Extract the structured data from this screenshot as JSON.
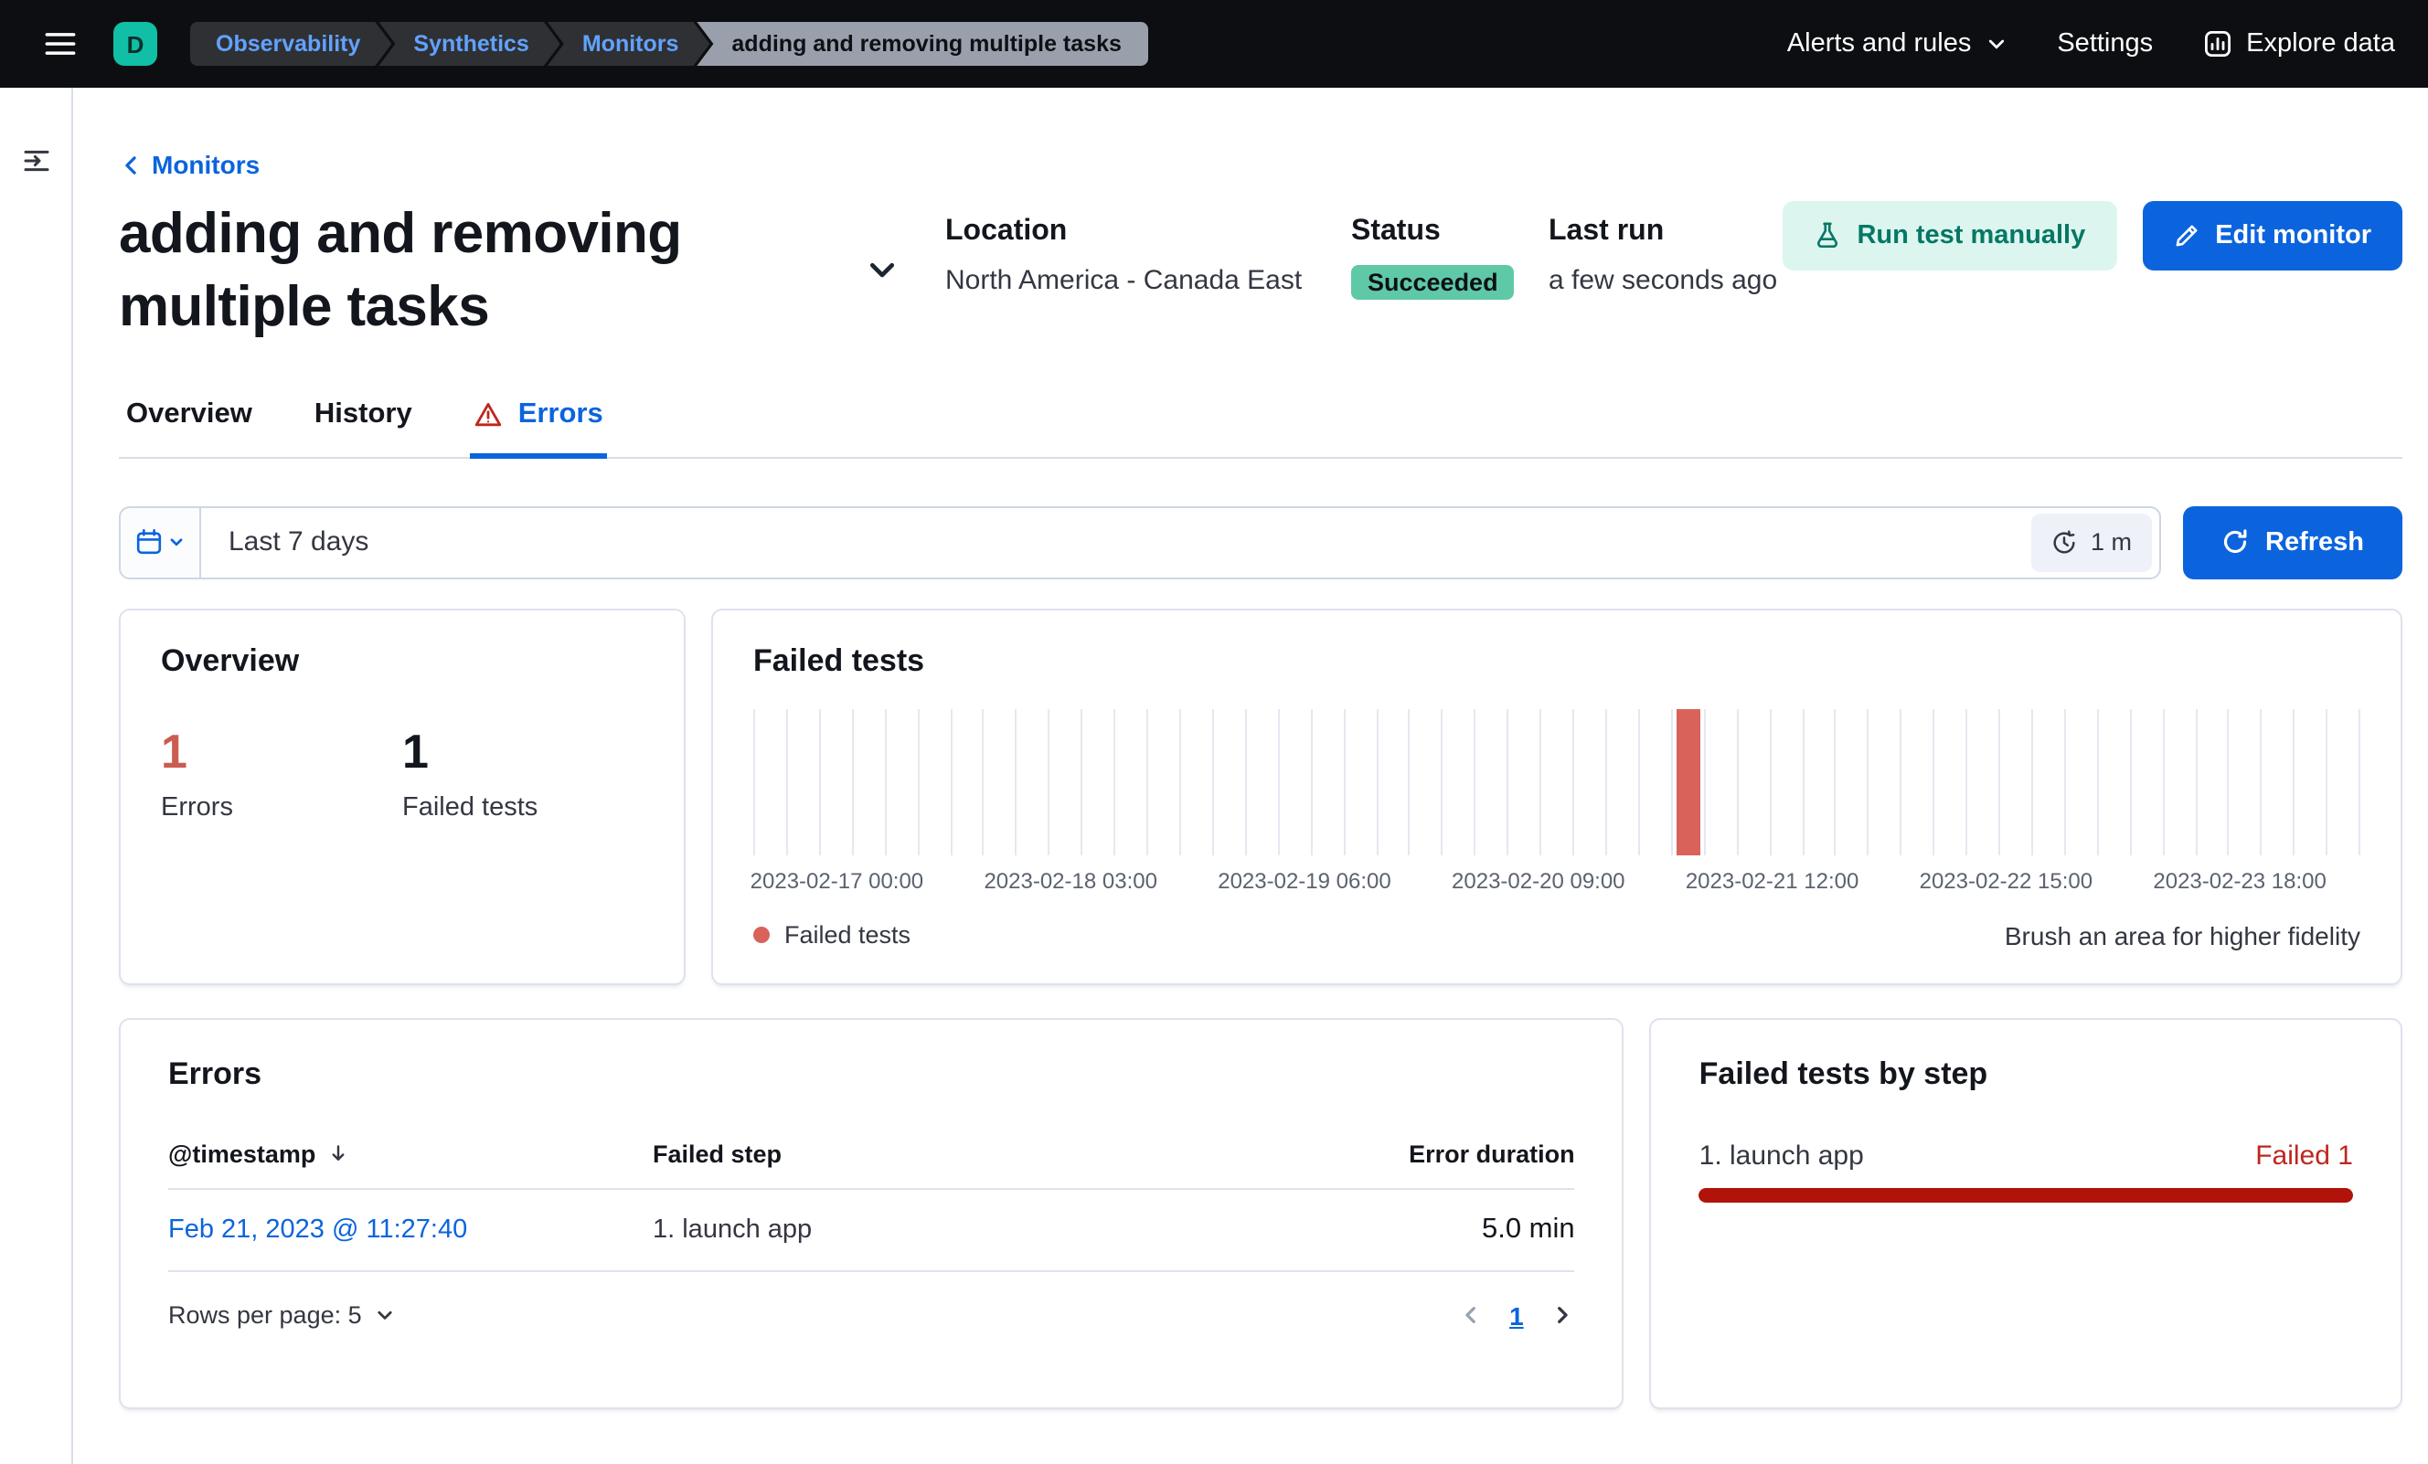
{
  "colors": {
    "header_bg": "#0d0e12",
    "logo_teal": "#10bfa5",
    "breadcrumb_link": "#61a2ff",
    "breadcrumb_current_bg": "#9aa0ab",
    "primary": "#0b64dd",
    "danger": "#bd271e",
    "bar_red": "#d9635a",
    "count_red": "#ca5c51",
    "progress_red": "#b1130a",
    "badge_success_bg": "#5fc9a7",
    "run_button_bg": "#dcf6ef",
    "run_button_text": "#077765"
  },
  "topbar": {
    "logo_letter": "D",
    "breadcrumbs": [
      "Observability",
      "Synthetics",
      "Monitors",
      "adding and removing multiple tasks"
    ],
    "alerts_menu": "Alerts and rules",
    "settings": "Settings",
    "explore_data": "Explore data"
  },
  "page": {
    "back_link": "Monitors",
    "title": "adding and removing multiple tasks",
    "location_label": "Location",
    "location_value": "North America - Canada East",
    "status_label": "Status",
    "status_value": "Succeeded",
    "last_run_label": "Last run",
    "last_run_value": "a few seconds ago",
    "run_test_button": "Run test manually",
    "edit_button": "Edit monitor"
  },
  "tabs": [
    {
      "label": "Overview",
      "active": false
    },
    {
      "label": "History",
      "active": false
    },
    {
      "label": "Errors",
      "active": true
    }
  ],
  "datebar": {
    "range": "Last 7 days",
    "interval": "1 m",
    "refresh_button": "Refresh"
  },
  "overview_card": {
    "title": "Overview",
    "errors_count": "1",
    "errors_label": "Errors",
    "failed_count": "1",
    "failed_label": "Failed tests"
  },
  "failed_tests_card": {
    "title": "Failed tests",
    "legend_label": "Failed tests",
    "brush_hint": "Brush an area for higher fidelity",
    "chart_data": {
      "type": "bar",
      "bucket_count": 49,
      "failed_bucket_index": 28,
      "bars": [
        {
          "time": "2023-02-21 11:00",
          "value": 1
        }
      ],
      "ylim": [
        0,
        1
      ],
      "x_ticks": [
        {
          "label": "2023-02-17 00:00",
          "pct": 5.2
        },
        {
          "label": "2023-02-18 03:00",
          "pct": 19.75
        },
        {
          "label": "2023-02-19 06:00",
          "pct": 34.3
        },
        {
          "label": "2023-02-20 09:00",
          "pct": 48.85
        },
        {
          "label": "2023-02-21 12:00",
          "pct": 63.4
        },
        {
          "label": "2023-02-22 15:00",
          "pct": 77.95
        },
        {
          "label": "2023-02-23 18:00",
          "pct": 92.5
        }
      ]
    }
  },
  "errors_card": {
    "title": "Errors",
    "columns": [
      "@timestamp",
      "Failed step",
      "Error duration"
    ],
    "rows": [
      {
        "timestamp": "Feb 21, 2023 @ 11:27:40",
        "failed_step": "1. launch app",
        "error_duration": "5.0 min"
      }
    ],
    "rows_per_page": "Rows per page: 5",
    "current_page": "1"
  },
  "failed_steps_card": {
    "title": "Failed tests by step",
    "steps": [
      {
        "label": "1. launch app",
        "result": "Failed 1",
        "percent": 100
      }
    ]
  }
}
